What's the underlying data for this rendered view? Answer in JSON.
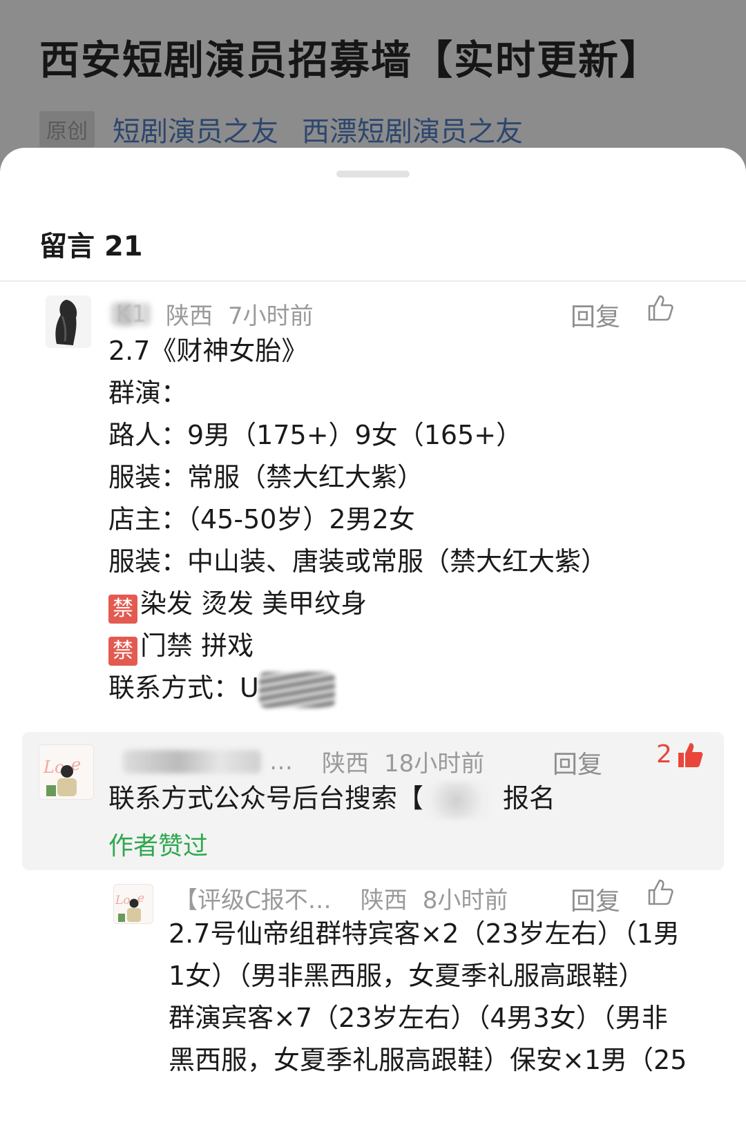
{
  "article": {
    "title": "西安短剧演员招募墙【实时更新】",
    "original_tag": "原创",
    "author_1": "短剧演员之友",
    "author_2": "西漂短剧演员之友"
  },
  "comments_header": {
    "label": "留言",
    "count": "21"
  },
  "comments": [
    {
      "username": "K1",
      "location": "陕西",
      "time": "7小时前",
      "reply_label": "回复",
      "lines": [
        "2.7《财神女胎》",
        "群演：",
        "路人：9男（175+）9女（165+）",
        "服装：常服（禁大红大紫）",
        "店主：（45-50岁）2男2女",
        "服装：中山装、唐装或常服（禁大红大紫）"
      ],
      "ban_badge": "禁",
      "ban_line_1": "染发 烫发 美甲纹身",
      "ban_line_2": "门禁 拼戏",
      "contact_label": "联系方式：U"
    },
    {
      "username": "…",
      "location": "陕西",
      "time": "18小时前",
      "reply_label": "回复",
      "like_count": "2",
      "text_prefix": "联系方式公众号后台搜索【",
      "text_suffix": "报名",
      "author_liked": "作者赞过"
    },
    {
      "username": "【评级C报不…",
      "location": "陕西",
      "time": "8小时前",
      "reply_label": "回复",
      "lines": [
        "2.7号仙帝组群特宾客×2（23岁左右）（1男",
        "1女）（男非黑西服，女夏季礼服高跟鞋）",
        "群演宾客×7（23岁左右）（4男3女）（男非",
        "黑西服，女夏季礼服高跟鞋）保安×1男（25"
      ]
    }
  ],
  "colors": {
    "like_red": "#e9463a",
    "author_liked_green": "#2fa84f",
    "ban_badge_red": "#e35a50"
  }
}
